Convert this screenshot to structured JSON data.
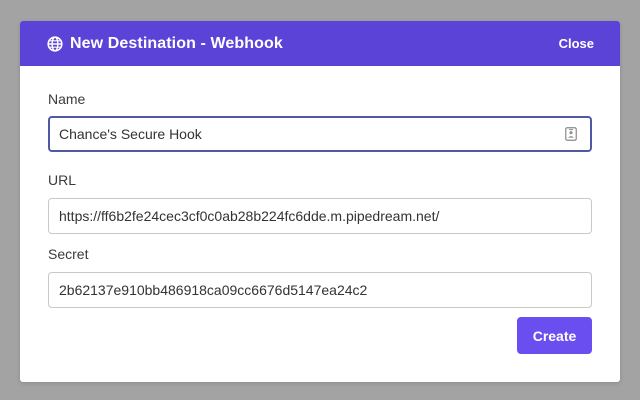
{
  "modal": {
    "title": "New Destination - Webhook",
    "close_label": "Close",
    "header_icon": "globe-icon"
  },
  "form": {
    "name": {
      "label": "Name",
      "value": "Chance's Secure Hook",
      "trailing_icon": "contact-card-icon"
    },
    "url": {
      "label": "URL",
      "value": "https://ff6b2fe24cec3cf0c0ab28b224fc6dde.m.pipedream.net/"
    },
    "secret": {
      "label": "Secret",
      "value": "2b62137e910bb486918ca09cc6676d5147ea24c2"
    }
  },
  "footer": {
    "create_label": "Create"
  },
  "colors": {
    "header_bg": "#5c43d8",
    "primary_button": "#6a4ef0",
    "focus_border": "#5358a6",
    "backdrop": "#a3a3a3"
  }
}
